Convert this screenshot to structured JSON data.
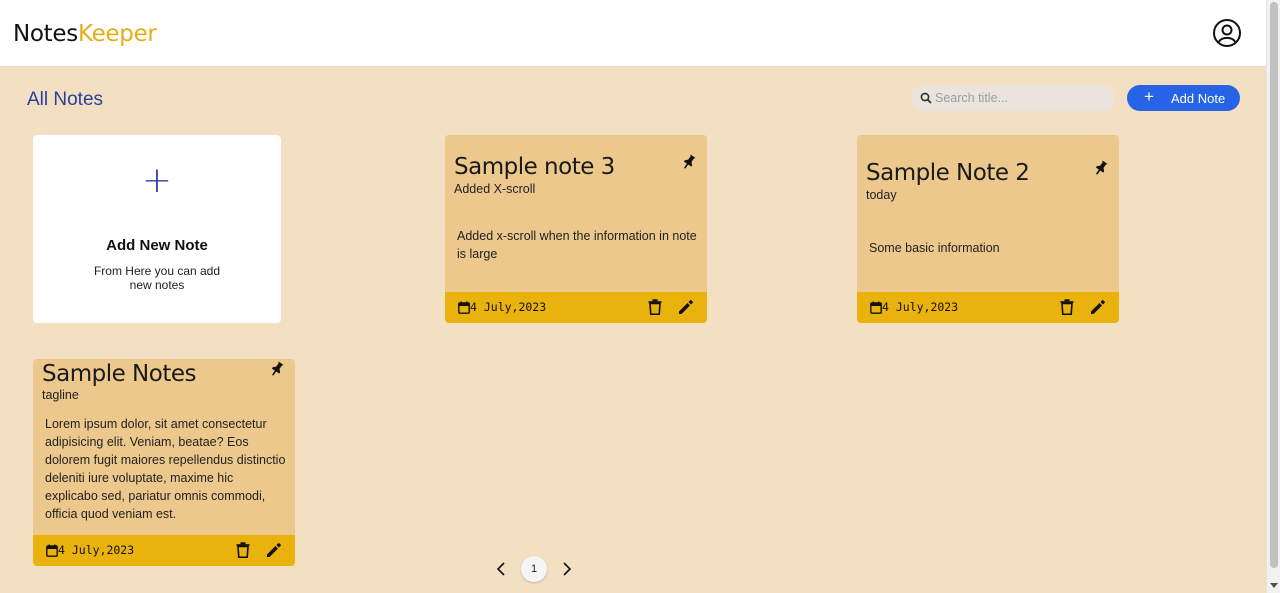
{
  "header": {
    "logo_part1": "Notes",
    "logo_part2": "Keeper",
    "user_icon": "user-circle-icon"
  },
  "main": {
    "title": "All Notes",
    "search": {
      "placeholder": "Search title...",
      "value": ""
    },
    "add_button_label": "Add Note",
    "add_button_icon": "+"
  },
  "new_note_card": {
    "icon": "+",
    "title": "Add New Note",
    "description": "From Here you can add new notes"
  },
  "notes": [
    {
      "title": "Sample note 3",
      "tagline": "Added X-scroll",
      "body": "Added x-scroll when the information in note is large",
      "date": "4 July,2023",
      "pinned": true
    },
    {
      "title": "Sample Note 2",
      "tagline": "today",
      "body": "Some basic information",
      "date": "4 July,2023",
      "pinned": true
    },
    {
      "title": "Sample Notes",
      "tagline": "tagline",
      "body": "Lorem ipsum dolor, sit amet consectetur adipisicing elit. Veniam, beatae? Eos dolorem fugit maiores repellendus distinctio deleniti iure voluptate, maxime hic explicabo sed, pariatur omnis commodi, officia quod veniam est.",
      "date": "4 July,2023",
      "pinned": true
    }
  ],
  "pagination": {
    "current_page": "1",
    "prev_icon": "chevron-left-icon",
    "next_icon": "chevron-right-icon"
  },
  "colors": {
    "background": "#f3dfc2",
    "note_card": "#edc88d",
    "note_footer": "#e9b20c",
    "accent_blue": "#2763e6",
    "title_blue": "#2b3f9c",
    "logo_yellow": "#e7ad17"
  }
}
